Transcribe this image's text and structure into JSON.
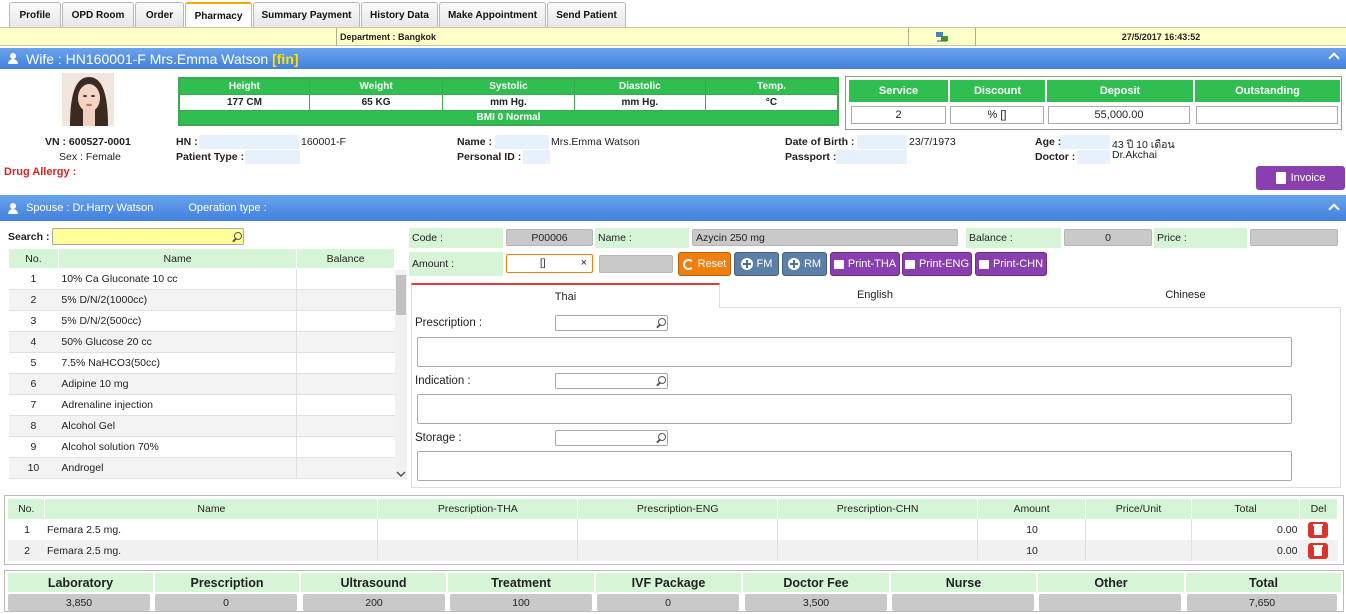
{
  "tabs": [
    "Profile",
    "OPD Room",
    "Order",
    "Pharmacy",
    "Summary Payment",
    "History Data",
    "Make Appointment",
    "Send Patient"
  ],
  "active_tab": "Pharmacy",
  "department": "Department : Bangkok",
  "datetime": "27/5/2017 16:43:52",
  "patient_bar": {
    "prefix": "Wife : HN160001-F Mrs.Emma Watson ",
    "tag": "[fin]"
  },
  "vitals": {
    "headers": [
      "Height",
      "Weight",
      "Systolic",
      "Diastolic",
      "Temp."
    ],
    "values": [
      "177 CM",
      "65 KG",
      "mm Hg.",
      "mm Hg.",
      "°C"
    ],
    "bmi": "BMI 0   Normal"
  },
  "finance": {
    "headers": [
      "Service",
      "Discount",
      "Deposit",
      "Outstanding"
    ],
    "values": [
      "2",
      "% []",
      "55,000.00",
      ""
    ]
  },
  "patient": {
    "vn": "VN : 600527-0001",
    "sex": "Sex : Female",
    "drug_allergy": "Drug Allergy :",
    "hn_label": "HN :",
    "hn": "160001-F",
    "patient_type_label": "Patient Type :",
    "name_label": "Name :",
    "name": "Mrs.Emma Watson",
    "personal_id_label": "Personal ID :",
    "dob_label": "Date of Birth :",
    "dob": "23/7/1973",
    "passport_label": "Passport :",
    "age_label": "Age :",
    "age": "43 ปี 10 เดือน",
    "doctor_label": "Doctor :",
    "doctor": "Dr.Akchai"
  },
  "invoice_label": "Invoice",
  "spouse_bar": {
    "spouse": "Spouse : Dr.Harry Watson",
    "operation": "Operation type :"
  },
  "search_label": "Search :",
  "drug_table": {
    "headers": [
      "No.",
      "Name",
      "Balance"
    ],
    "rows": [
      [
        "1",
        "10% Ca Gluconate 10 cc",
        ""
      ],
      [
        "2",
        "5% D/N/2(1000cc)",
        ""
      ],
      [
        "3",
        "5% D/N/2(500cc)",
        ""
      ],
      [
        "4",
        "50% Glucose 20 cc",
        ""
      ],
      [
        "5",
        "7.5% NaHCO3(50cc)",
        ""
      ],
      [
        "6",
        "Adipine 10 mg",
        ""
      ],
      [
        "7",
        "Adrenaline injection",
        ""
      ],
      [
        "8",
        "Alcohol Gel",
        ""
      ],
      [
        "9",
        "Alcohol solution 70%",
        ""
      ],
      [
        "10",
        "Androgel",
        ""
      ]
    ]
  },
  "detail": {
    "code_label": "Code :",
    "code": "P00006",
    "name_label": "Name :",
    "name": "Azycin 250 mg",
    "balance_label": "Balance :",
    "balance": "0",
    "price_label": "Price :",
    "price": "",
    "amount_label": "Amount :",
    "amount": "[]"
  },
  "buttons": [
    "Reset",
    "FM",
    "RM",
    "Print-THA",
    "Print-ENG",
    "Print-CHN"
  ],
  "lang_tabs": [
    "Thai",
    "English",
    "Chinese"
  ],
  "fields": [
    "Prescription :",
    "Indication :",
    "Storage :"
  ],
  "items": {
    "headers": [
      "No.",
      "Name",
      "Prescription-THA",
      "Prescription-ENG",
      "Prescription-CHN",
      "Amount",
      "Price/Unit",
      "Total",
      "Del"
    ],
    "rows": [
      [
        "1",
        "Femara 2.5 mg.",
        "",
        "",
        "",
        "10",
        "",
        "0.00"
      ],
      [
        "2",
        "Femara 2.5 mg.",
        "",
        "",
        "",
        "10",
        "",
        "0.00"
      ]
    ]
  },
  "summary": {
    "headers": [
      "Laboratory",
      "Prescription",
      "Ultrasound",
      "Treatment",
      "IVF Package",
      "Doctor Fee",
      "Nurse",
      "Other",
      "Total"
    ],
    "values": [
      "3,850",
      "0",
      "200",
      "100",
      "0",
      "3,500",
      "",
      "",
      "7,650"
    ]
  },
  "colors": {
    "accent_green": "#2fbe4f",
    "bar_blue": "#4a8ae4",
    "reset": "#f07f10",
    "fm_rm": "#5b7fa6",
    "print": "#8a3fb0",
    "drug_allergy": "#e02020"
  }
}
